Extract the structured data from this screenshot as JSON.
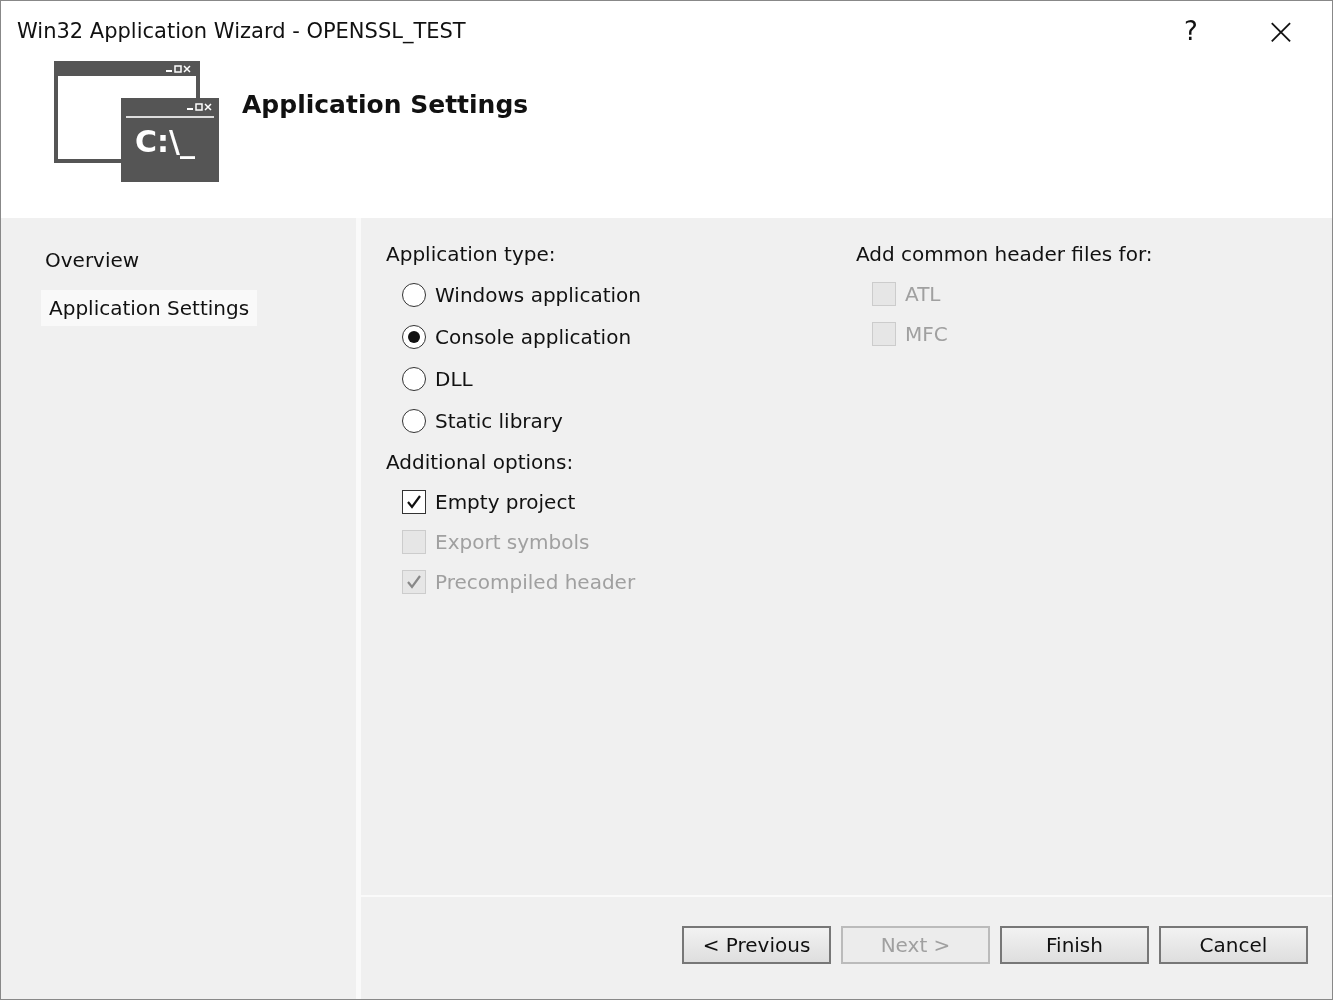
{
  "window": {
    "title": "Win32 Application Wizard - OPENSSL_TEST",
    "help": "?",
    "close": "×"
  },
  "header": {
    "icon_text": "C:\\_",
    "title": "Application Settings"
  },
  "sidebar": {
    "items": [
      {
        "label": "Overview",
        "selected": false
      },
      {
        "label": "Application Settings",
        "selected": true
      }
    ]
  },
  "application_type": {
    "label": "Application type:",
    "options": [
      {
        "label": "Windows application",
        "selected": false
      },
      {
        "label": "Console application",
        "selected": true
      },
      {
        "label": "DLL",
        "selected": false
      },
      {
        "label": "Static library",
        "selected": false
      }
    ]
  },
  "additional_options": {
    "label": "Additional options:",
    "options": [
      {
        "label": "Empty project",
        "checked": true,
        "disabled": false
      },
      {
        "label": "Export symbols",
        "checked": false,
        "disabled": true
      },
      {
        "label": "Precompiled header",
        "checked": true,
        "disabled": true
      }
    ]
  },
  "common_headers": {
    "label": "Add common header files for:",
    "options": [
      {
        "label": "ATL",
        "checked": false,
        "disabled": true
      },
      {
        "label": "MFC",
        "checked": false,
        "disabled": true
      }
    ]
  },
  "buttons": [
    {
      "label": "< Previous",
      "disabled": false
    },
    {
      "label": "Next >",
      "disabled": true
    },
    {
      "label": "Finish",
      "disabled": false
    },
    {
      "label": "Cancel",
      "disabled": false
    }
  ]
}
